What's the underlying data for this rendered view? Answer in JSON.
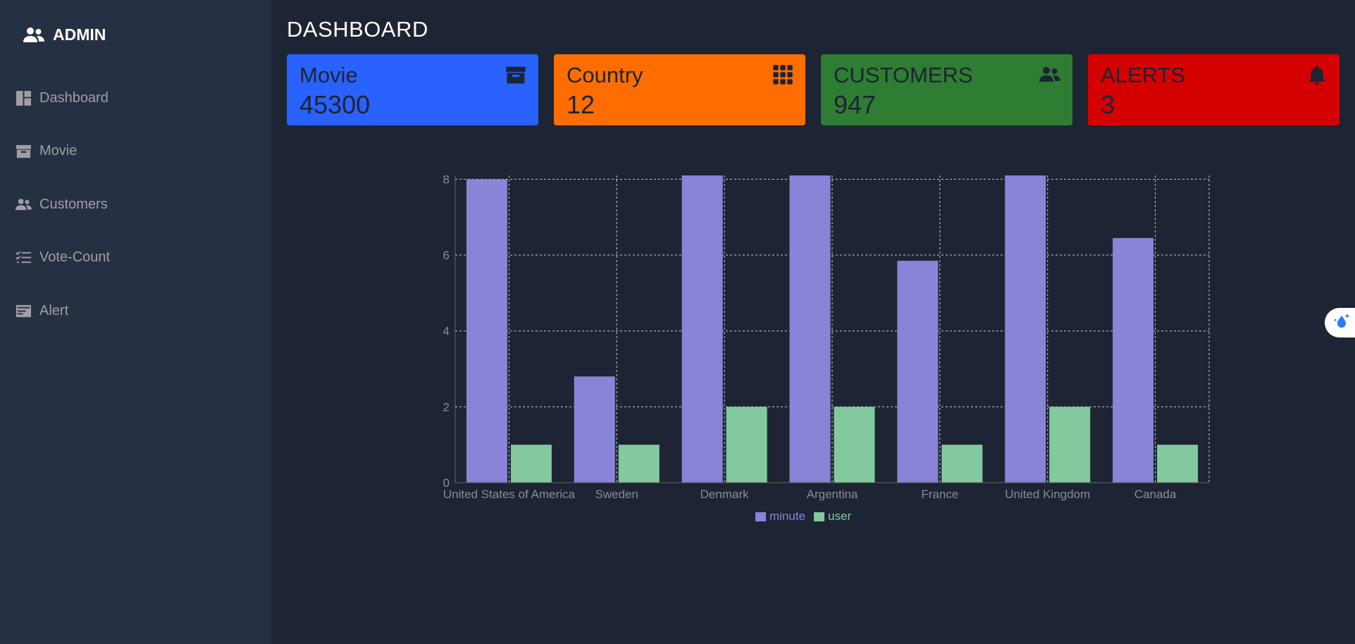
{
  "sidebar": {
    "brand": {
      "label": "ADMIN",
      "icon": "users-icon"
    },
    "items": [
      {
        "label": "Dashboard",
        "icon": "dashboard-icon"
      },
      {
        "label": "Movie",
        "icon": "archive-icon"
      },
      {
        "label": "Customers",
        "icon": "users-icon"
      },
      {
        "label": "Vote-Count",
        "icon": "list-check-icon"
      },
      {
        "label": "Alert",
        "icon": "alert-card-icon"
      }
    ]
  },
  "main": {
    "title": "DASHBOARD",
    "cards": [
      {
        "label": "Movie",
        "value": "45300",
        "icon": "archive-icon",
        "color": "#2962ff"
      },
      {
        "label": "Country",
        "value": "12",
        "icon": "grid-icon",
        "color": "#ff6d00"
      },
      {
        "label": "CUSTOMERS",
        "value": "947",
        "icon": "users-icon",
        "color": "#2e7d32"
      },
      {
        "label": "ALERTS",
        "value": "3",
        "icon": "bell-icon",
        "color": "#d50000"
      }
    ]
  },
  "chart_data": {
    "type": "bar",
    "categories": [
      "United States of America",
      "Sweden",
      "Denmark",
      "Argentina",
      "France",
      "United Kingdom",
      "Canada"
    ],
    "series": [
      {
        "name": "minute",
        "color": "#8884d8",
        "values": [
          8,
          2.8,
          8.1,
          8.1,
          5.85,
          8.1,
          6.45
        ]
      },
      {
        "name": "user",
        "color": "#82ca9d",
        "values": [
          1,
          1,
          2,
          2,
          1,
          2,
          1
        ]
      }
    ],
    "yticks": [
      0,
      2,
      4,
      6,
      8
    ],
    "ylim": [
      0,
      8.1
    ],
    "grid": true,
    "legend_position": "bottom-center"
  },
  "floating_widget": {
    "icon": "droplet-sparkle-icon"
  }
}
